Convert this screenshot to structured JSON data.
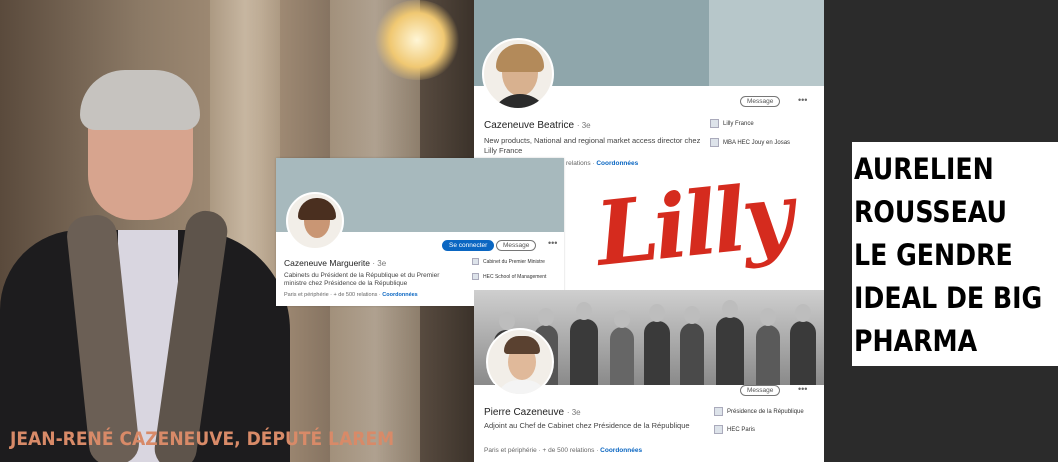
{
  "left_photo": {
    "caption": "JEAN-RENÉ CAZENEUVE, DÉPUTÉ LAREM"
  },
  "profiles": [
    {
      "name": "Cazeneuve Beatrice",
      "degree": "· 3e",
      "title": "New products, National and regional market access director chez Lilly France",
      "meta_suffix": "relations ·",
      "meta_link": "Coordonnées",
      "buttons": [
        "Message"
      ],
      "affiliations": [
        "Lilly France",
        "MBA HEC Jouy en Josas"
      ]
    },
    {
      "name": "Cazeneuve Marguerite",
      "degree": "· 3e",
      "title": "Cabinets du Président de la République et du Premier ministre chez Présidence de la République",
      "meta_prefix": "Paris et périphérie · + de 500 relations ·",
      "meta_link": "Coordonnées",
      "buttons": [
        "Se connecter",
        "Message"
      ],
      "affiliations": [
        "Cabinet du Premier Ministre",
        "HEC School of Management"
      ]
    },
    {
      "name": "Pierre Cazeneuve",
      "degree": "· 3e",
      "title": "Adjoint au Chef de Cabinet chez Présidence de la République",
      "meta_prefix": "Paris et périphérie · + de 500 relations ·",
      "meta_link": "Coordonnées",
      "buttons": [
        "Message"
      ],
      "affiliations": [
        "Présidence de la République",
        "HEC Paris"
      ]
    }
  ],
  "logo": {
    "text": "Lilly",
    "color": "#d52b1e"
  },
  "headline": {
    "lines": [
      "AURELIEN",
      "ROUSSEAU",
      "LE GENDRE",
      "IDEAL DE BIG",
      "PHARMA"
    ]
  },
  "colors": {
    "linkedin_blue": "#0a66c2",
    "banner": "#a7b9bd",
    "caption": "#d88a68"
  }
}
